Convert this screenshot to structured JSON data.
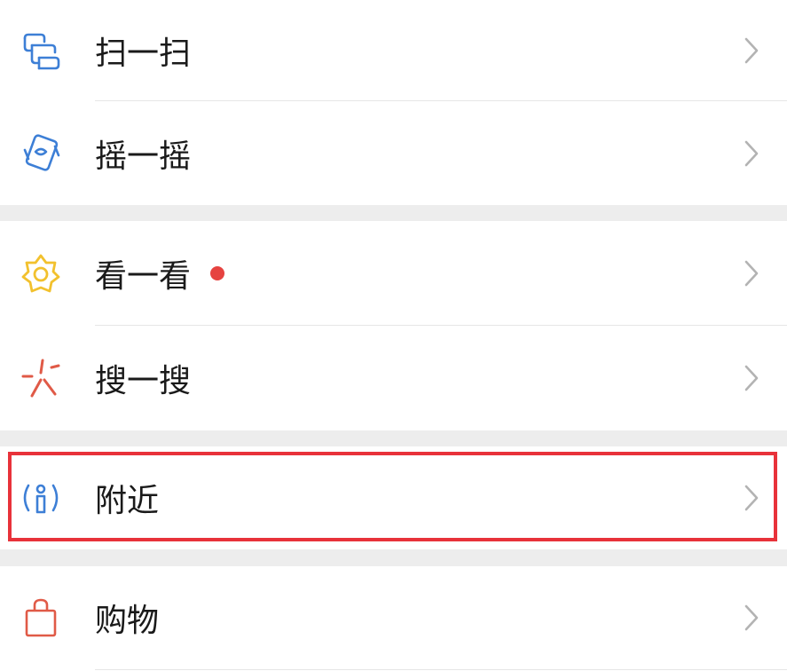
{
  "colors": {
    "background": "#ededed",
    "row_background": "#ffffff",
    "text": "#1a1a1a",
    "chevron": "#b3b3b3",
    "divider": "#e6e6e6",
    "badge_dot": "#e64340",
    "highlight_border": "#e8323a",
    "icon_blue": "#3d7fd6",
    "icon_yellow": "#f2c12e",
    "icon_red": "#e05a47"
  },
  "menu": {
    "items": [
      {
        "label": "扫一扫",
        "icon": "scan-icon"
      },
      {
        "label": "摇一摇",
        "icon": "shake-icon"
      },
      {
        "label": "看一看",
        "icon": "top-stories-icon",
        "badge": "red-dot"
      },
      {
        "label": "搜一搜",
        "icon": "search-sparkle-icon"
      },
      {
        "label": "附近",
        "icon": "nearby-icon",
        "highlighted": true
      },
      {
        "label": "购物",
        "icon": "shopping-bag-icon"
      }
    ]
  }
}
